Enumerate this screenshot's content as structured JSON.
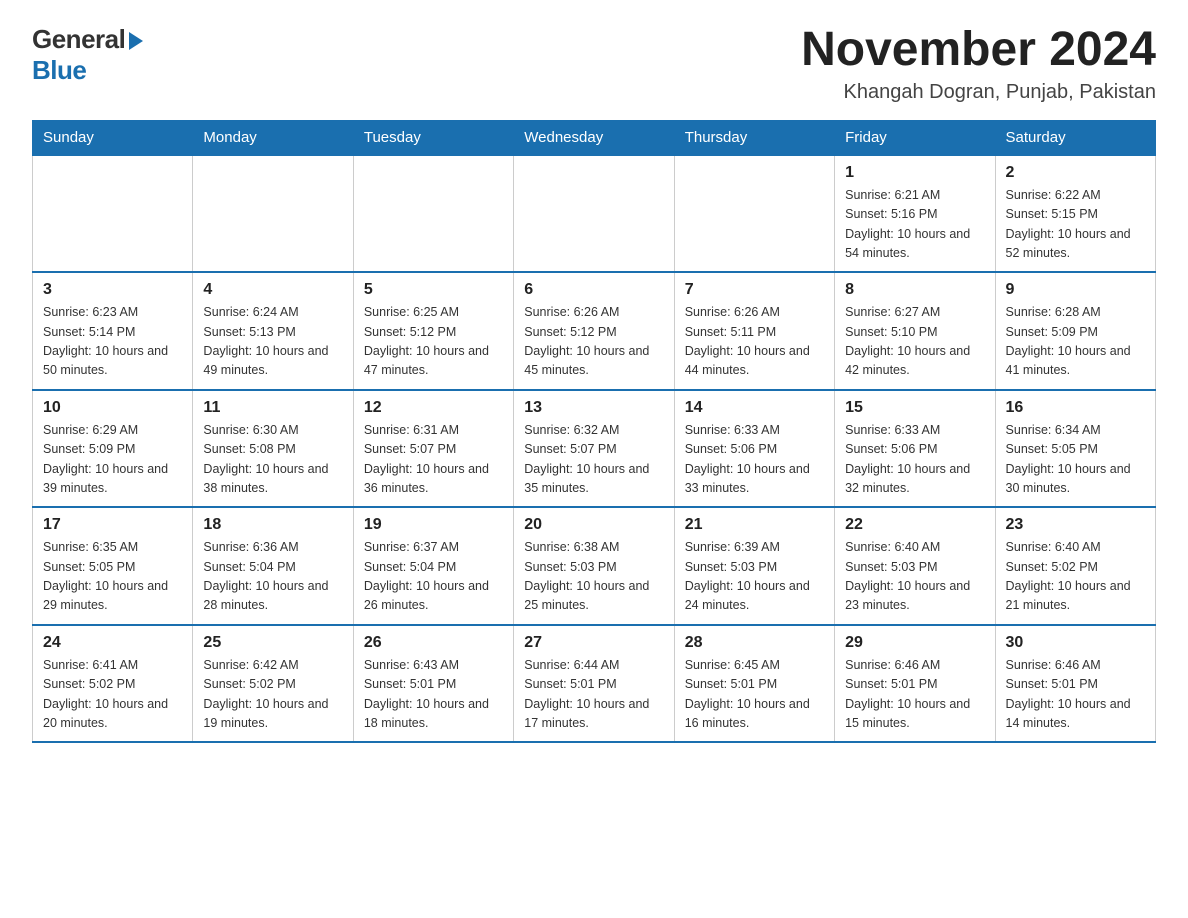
{
  "header": {
    "logo_general": "General",
    "logo_blue": "Blue",
    "month": "November 2024",
    "location": "Khangah Dogran, Punjab, Pakistan"
  },
  "days_of_week": [
    "Sunday",
    "Monday",
    "Tuesday",
    "Wednesday",
    "Thursday",
    "Friday",
    "Saturday"
  ],
  "weeks": [
    [
      {
        "day": "",
        "info": ""
      },
      {
        "day": "",
        "info": ""
      },
      {
        "day": "",
        "info": ""
      },
      {
        "day": "",
        "info": ""
      },
      {
        "day": "",
        "info": ""
      },
      {
        "day": "1",
        "info": "Sunrise: 6:21 AM\nSunset: 5:16 PM\nDaylight: 10 hours and 54 minutes."
      },
      {
        "day": "2",
        "info": "Sunrise: 6:22 AM\nSunset: 5:15 PM\nDaylight: 10 hours and 52 minutes."
      }
    ],
    [
      {
        "day": "3",
        "info": "Sunrise: 6:23 AM\nSunset: 5:14 PM\nDaylight: 10 hours and 50 minutes."
      },
      {
        "day": "4",
        "info": "Sunrise: 6:24 AM\nSunset: 5:13 PM\nDaylight: 10 hours and 49 minutes."
      },
      {
        "day": "5",
        "info": "Sunrise: 6:25 AM\nSunset: 5:12 PM\nDaylight: 10 hours and 47 minutes."
      },
      {
        "day": "6",
        "info": "Sunrise: 6:26 AM\nSunset: 5:12 PM\nDaylight: 10 hours and 45 minutes."
      },
      {
        "day": "7",
        "info": "Sunrise: 6:26 AM\nSunset: 5:11 PM\nDaylight: 10 hours and 44 minutes."
      },
      {
        "day": "8",
        "info": "Sunrise: 6:27 AM\nSunset: 5:10 PM\nDaylight: 10 hours and 42 minutes."
      },
      {
        "day": "9",
        "info": "Sunrise: 6:28 AM\nSunset: 5:09 PM\nDaylight: 10 hours and 41 minutes."
      }
    ],
    [
      {
        "day": "10",
        "info": "Sunrise: 6:29 AM\nSunset: 5:09 PM\nDaylight: 10 hours and 39 minutes."
      },
      {
        "day": "11",
        "info": "Sunrise: 6:30 AM\nSunset: 5:08 PM\nDaylight: 10 hours and 38 minutes."
      },
      {
        "day": "12",
        "info": "Sunrise: 6:31 AM\nSunset: 5:07 PM\nDaylight: 10 hours and 36 minutes."
      },
      {
        "day": "13",
        "info": "Sunrise: 6:32 AM\nSunset: 5:07 PM\nDaylight: 10 hours and 35 minutes."
      },
      {
        "day": "14",
        "info": "Sunrise: 6:33 AM\nSunset: 5:06 PM\nDaylight: 10 hours and 33 minutes."
      },
      {
        "day": "15",
        "info": "Sunrise: 6:33 AM\nSunset: 5:06 PM\nDaylight: 10 hours and 32 minutes."
      },
      {
        "day": "16",
        "info": "Sunrise: 6:34 AM\nSunset: 5:05 PM\nDaylight: 10 hours and 30 minutes."
      }
    ],
    [
      {
        "day": "17",
        "info": "Sunrise: 6:35 AM\nSunset: 5:05 PM\nDaylight: 10 hours and 29 minutes."
      },
      {
        "day": "18",
        "info": "Sunrise: 6:36 AM\nSunset: 5:04 PM\nDaylight: 10 hours and 28 minutes."
      },
      {
        "day": "19",
        "info": "Sunrise: 6:37 AM\nSunset: 5:04 PM\nDaylight: 10 hours and 26 minutes."
      },
      {
        "day": "20",
        "info": "Sunrise: 6:38 AM\nSunset: 5:03 PM\nDaylight: 10 hours and 25 minutes."
      },
      {
        "day": "21",
        "info": "Sunrise: 6:39 AM\nSunset: 5:03 PM\nDaylight: 10 hours and 24 minutes."
      },
      {
        "day": "22",
        "info": "Sunrise: 6:40 AM\nSunset: 5:03 PM\nDaylight: 10 hours and 23 minutes."
      },
      {
        "day": "23",
        "info": "Sunrise: 6:40 AM\nSunset: 5:02 PM\nDaylight: 10 hours and 21 minutes."
      }
    ],
    [
      {
        "day": "24",
        "info": "Sunrise: 6:41 AM\nSunset: 5:02 PM\nDaylight: 10 hours and 20 minutes."
      },
      {
        "day": "25",
        "info": "Sunrise: 6:42 AM\nSunset: 5:02 PM\nDaylight: 10 hours and 19 minutes."
      },
      {
        "day": "26",
        "info": "Sunrise: 6:43 AM\nSunset: 5:01 PM\nDaylight: 10 hours and 18 minutes."
      },
      {
        "day": "27",
        "info": "Sunrise: 6:44 AM\nSunset: 5:01 PM\nDaylight: 10 hours and 17 minutes."
      },
      {
        "day": "28",
        "info": "Sunrise: 6:45 AM\nSunset: 5:01 PM\nDaylight: 10 hours and 16 minutes."
      },
      {
        "day": "29",
        "info": "Sunrise: 6:46 AM\nSunset: 5:01 PM\nDaylight: 10 hours and 15 minutes."
      },
      {
        "day": "30",
        "info": "Sunrise: 6:46 AM\nSunset: 5:01 PM\nDaylight: 10 hours and 14 minutes."
      }
    ]
  ]
}
